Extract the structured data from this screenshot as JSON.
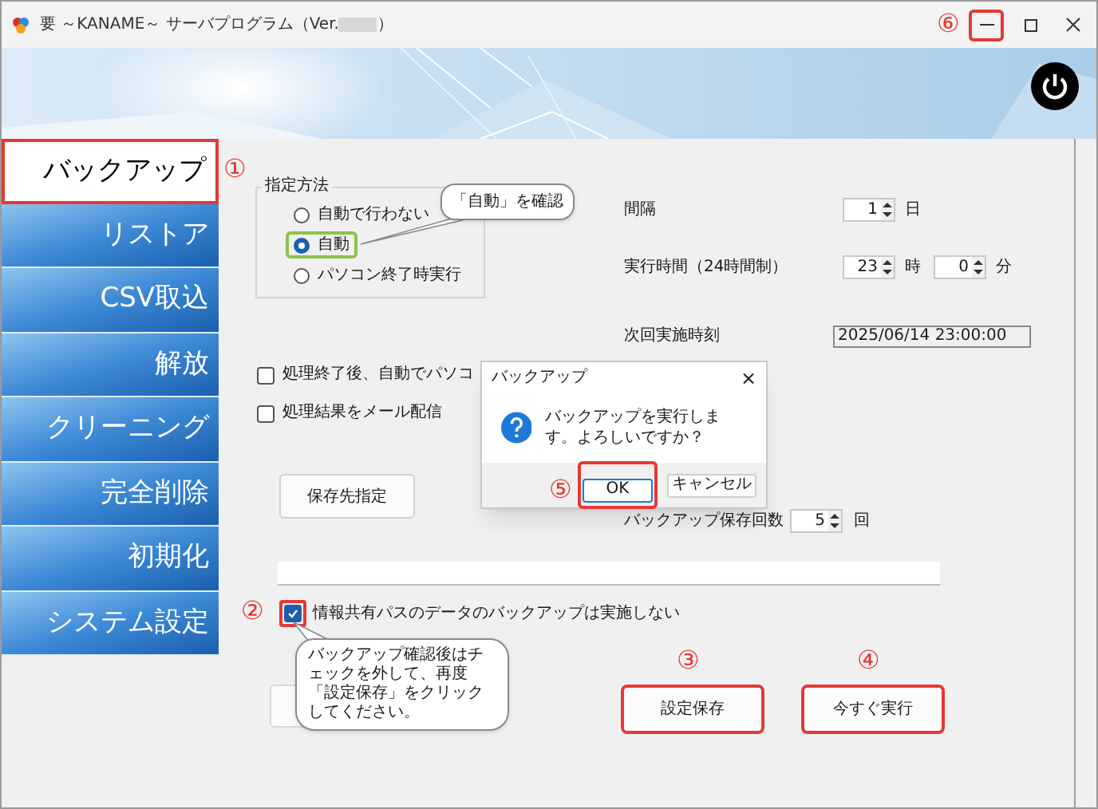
{
  "window": {
    "title": "要 ～KANAME～ サーバプログラム（Ver.",
    "title_end": "）",
    "minimize_highlighted": true,
    "minimize_marker": "⑥"
  },
  "sidebar": {
    "items": [
      {
        "label": "バックアップ",
        "selected": true,
        "highlighted": true,
        "marker": "①"
      },
      {
        "label": "リストア",
        "selected": false,
        "highlighted": false
      },
      {
        "label": "CSV取込",
        "selected": false,
        "highlighted": false
      },
      {
        "label": "解放",
        "selected": false,
        "highlighted": false
      },
      {
        "label": "クリーニング",
        "selected": false,
        "highlighted": false
      },
      {
        "label": "完全削除",
        "selected": false,
        "highlighted": false
      },
      {
        "label": "初期化",
        "selected": false,
        "highlighted": false
      },
      {
        "label": "システム設定",
        "selected": false,
        "highlighted": false
      }
    ]
  },
  "method_group": {
    "title": "指定方法",
    "options": [
      {
        "kind": "plain",
        "label": "自動で行わない",
        "selected": false
      },
      {
        "kind": "outlined",
        "label": "自動",
        "selected": true
      },
      {
        "kind": "plain",
        "label": "パソコン終了時実行",
        "selected": false
      }
    ]
  },
  "checkboxes": [
    {
      "label": "処理終了後、自動でパソコ",
      "checked": false
    },
    {
      "label": "処理結果をメール配信",
      "checked": false
    }
  ],
  "save_location_button": "保存先指定",
  "schedule": [
    {
      "label": "間隔",
      "fields": [
        {
          "value": "1",
          "unit": "日"
        }
      ]
    },
    {
      "label": "実行時間（24時間制）",
      "fields": [
        {
          "value": "23",
          "unit": "時"
        },
        {
          "value": "0",
          "unit": "分"
        }
      ]
    }
  ],
  "next_run": {
    "label": "次回実施時刻",
    "value": "2025/06/14 23:00:00"
  },
  "keep_count": {
    "label": "バックアップ保存回数",
    "value": "5",
    "unit": "回"
  },
  "progress": {
    "level": 0
  },
  "share_checkbox": {
    "label": "情報共有パスのデータのバックアップは実施しない",
    "checked": true,
    "highlighted": true,
    "marker": "②"
  },
  "buttons": [
    {
      "label": "設定保存",
      "highlighted": true,
      "marker": "③"
    },
    {
      "label": "今すぐ実行",
      "highlighted": true,
      "marker": "④"
    }
  ],
  "dialog": {
    "title": "バックアップ",
    "close": "×",
    "message": "バックアップを実行します。よろしいですか？",
    "ok": "OK",
    "ok_highlighted": true,
    "ok_marker": "⑤",
    "cancel": "キャンセル"
  },
  "callouts": [
    {
      "text": "「自動」を確認"
    },
    {
      "text": "バックアップ確認後はチェックを外して、再度「設定保存」をクリックしてください。"
    }
  ]
}
